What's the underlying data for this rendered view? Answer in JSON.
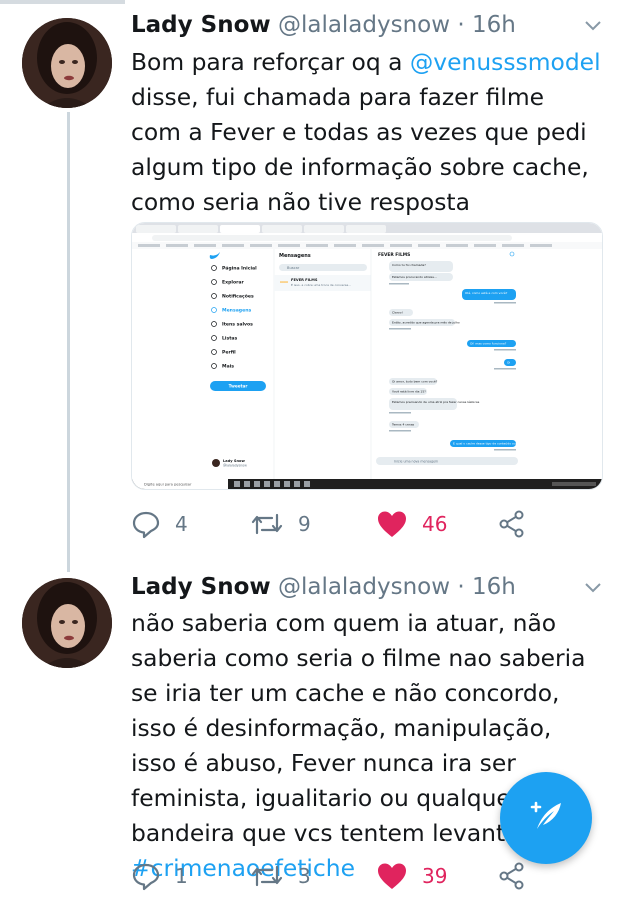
{
  "tweets": [
    {
      "name": "Lady Snow",
      "handle": "@lalaladysnow",
      "time": "· 16h",
      "text_before": "Bom para reforçar oq a ",
      "mention": "@venusssmodel",
      "text_after": " disse, fui chamada para fazer filme com a Fever e todas as vezes que pedi algum tipo de informação sobre cache, como seria não tive resposta",
      "replies": "4",
      "retweets": "9",
      "likes": "46"
    },
    {
      "name": "Lady Snow",
      "handle": "@lalaladysnow",
      "time": "· 16h",
      "text_before": "não saberia com quem ia atuar, não saberia como seria o filme nao saberia se iria ter um cache e não concordo, isso é desinformação, manipulação, isso é abuso, Fever nunca ira ser feminista, igualitario ou qualquer bandeira que vcs tentem levantar. ",
      "hashtag": "#crimenaoefetiche",
      "replies": "1",
      "retweets": "3",
      "likes": "39"
    }
  ],
  "screenshot": {
    "nav": [
      "Página Inicial",
      "Explorar",
      "Notificações",
      "Mensagens",
      "Itens salvos",
      "Listas",
      "Perfil",
      "Mais"
    ],
    "tweet_button": "Tweetar",
    "messages_title": "Mensagens",
    "search_placeholder": "Buscar",
    "conversation_name": "FEVER FILMS",
    "conversation_preview": "É isso. a cobre uma troca de conversa...",
    "chat_title": "FEVER FILMS",
    "message_input": "Inicie uma nova mensagem",
    "taskbar_search": "Digite aqui para pesquisar",
    "profile_name": "Lady Snow",
    "profile_handle": "@lalaladysnow",
    "received": [
      "Como tu foi chamada?",
      "Estamos procurando atrizes...",
      "Claroo!",
      "Então, acredito que agenda pra mês de julho",
      "Oi amor, tudo bem com você?",
      "Você está livre dia 15?",
      "Estamos precisando de uma atriz pra fazer cenas lésbicas",
      "Temos 4 cenas"
    ],
    "sent": [
      "Olá, como está e com você?",
      "Oi! mas como funciona?",
      "Oi",
      "E qual o cache desse tipo de conteúdo ou cache?"
    ]
  },
  "colors": {
    "accent": "#1da1f2",
    "like": "#e0245e",
    "muted": "#657786"
  }
}
